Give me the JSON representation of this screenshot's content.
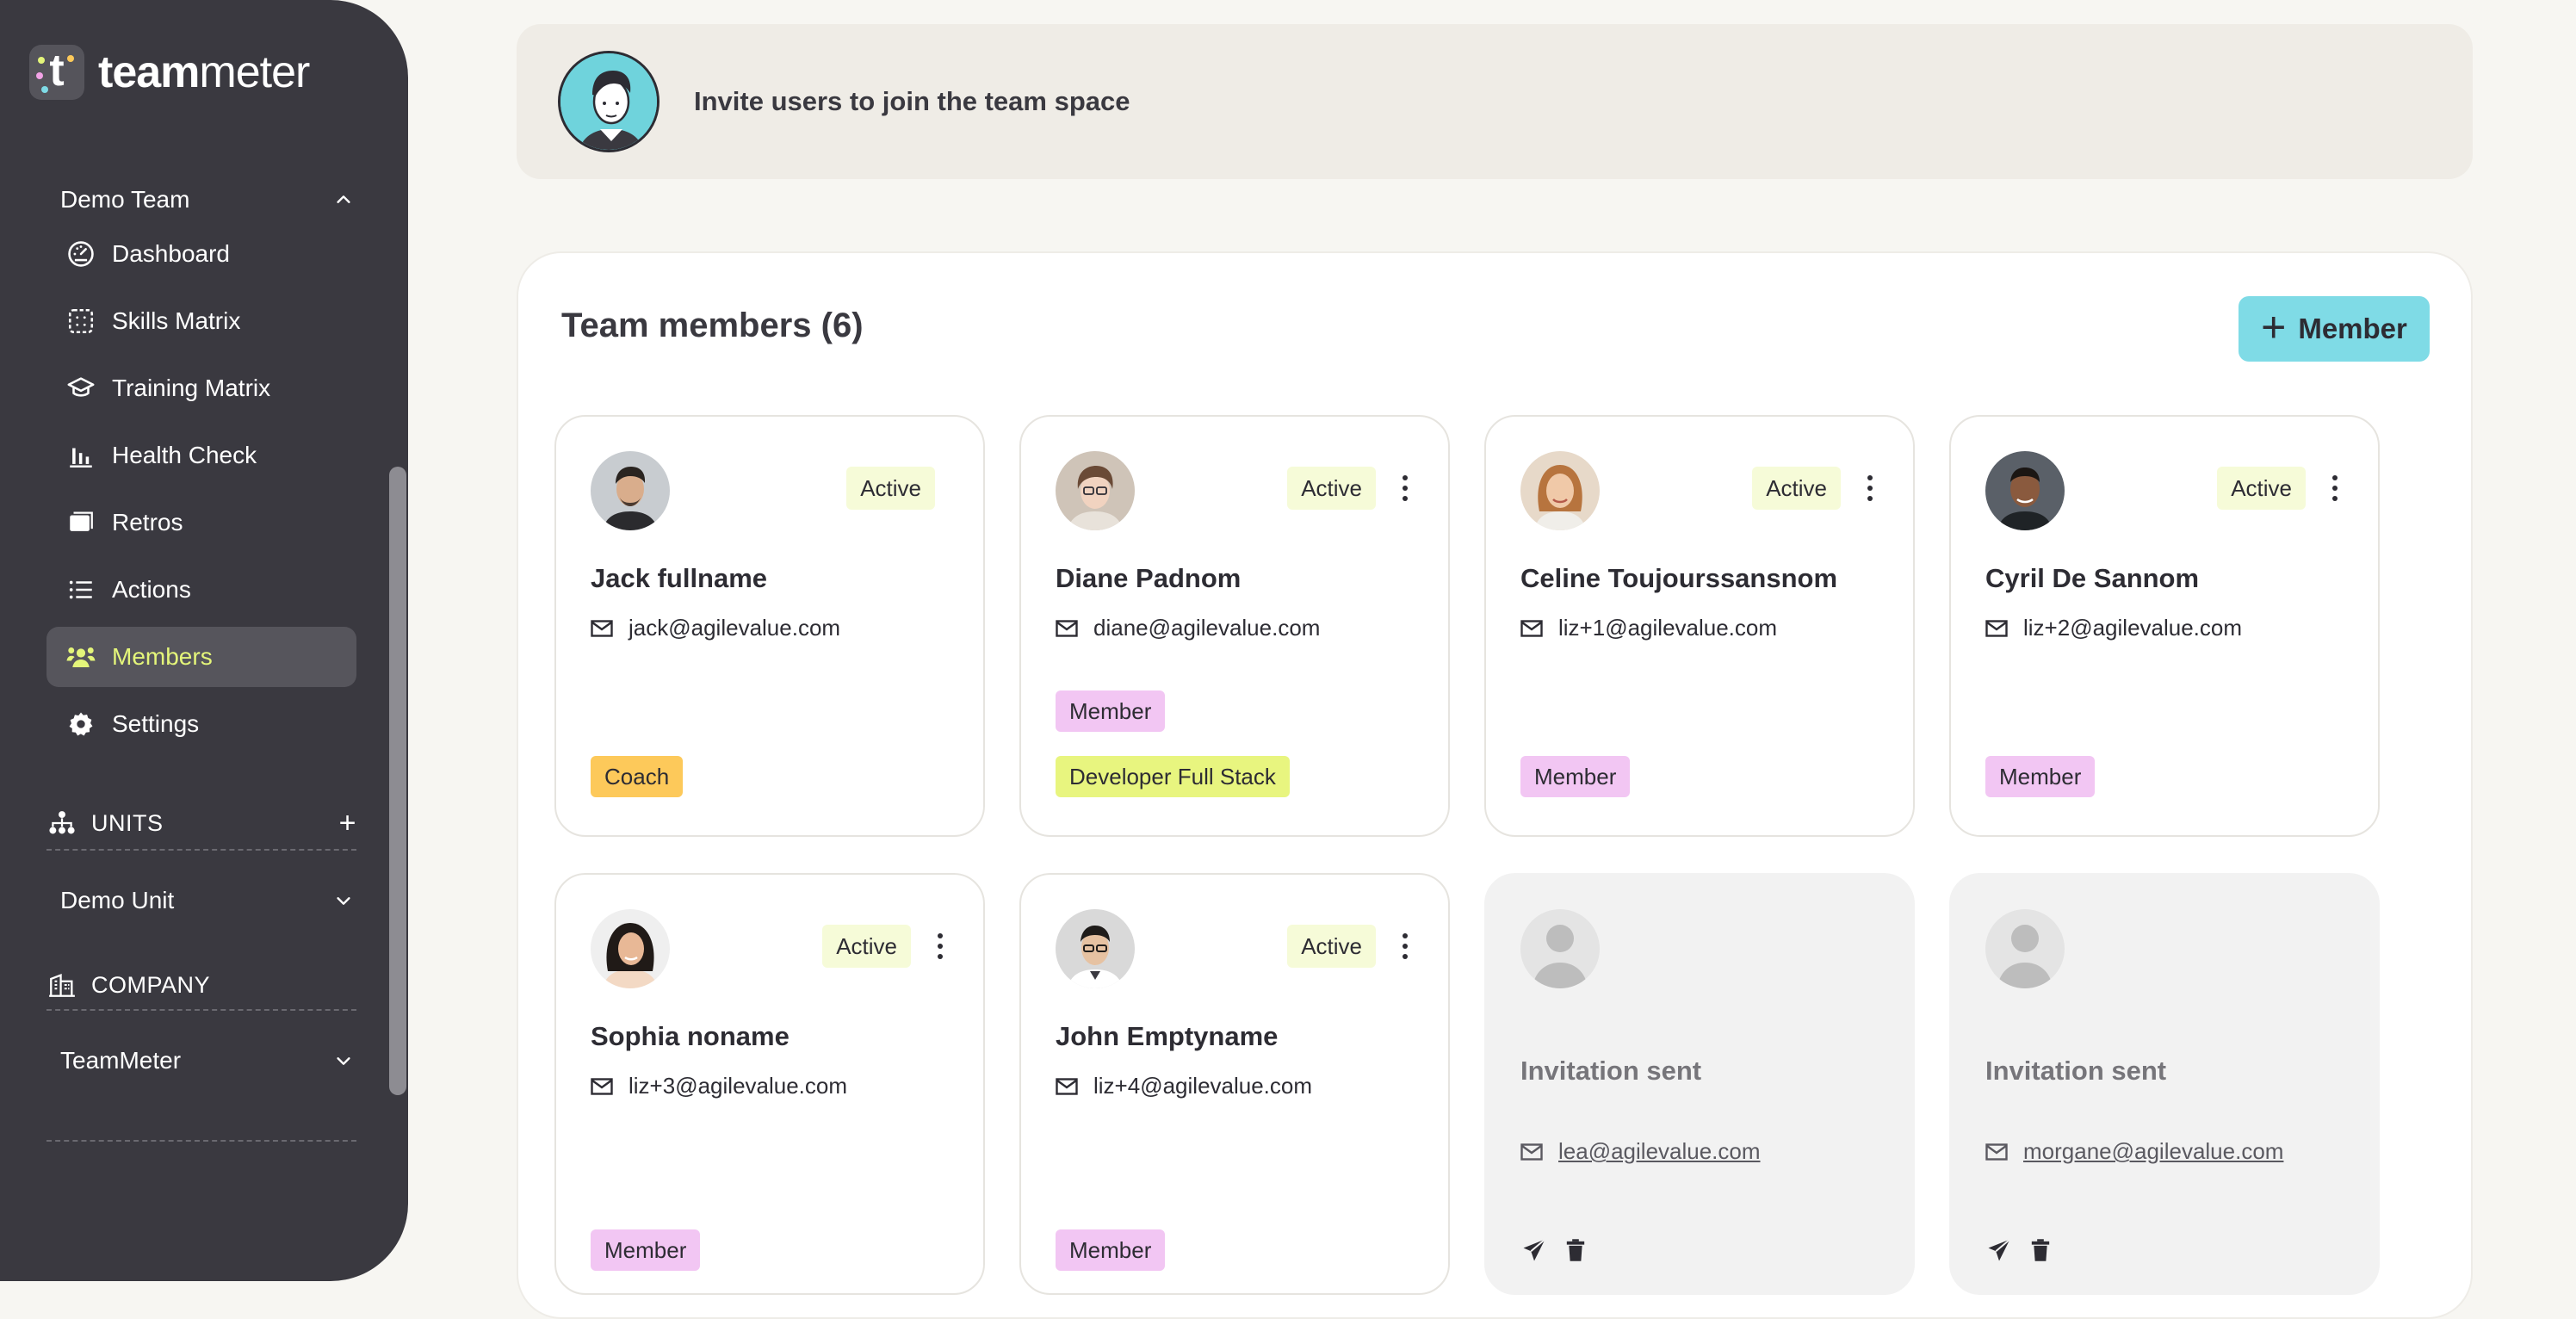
{
  "brand": {
    "name_bold": "team",
    "name_light": "meter",
    "logo_letter": "t",
    "colors": {
      "sidebar": "#3a3940",
      "active_text": "#e4f57a",
      "accent_button": "#7fdbe6",
      "status_bg": "#f6fbd8",
      "coach_tag": "#fdc95a",
      "member_tag": "#f2c6f3",
      "dev_tag": "#e8f57f"
    }
  },
  "sidebar": {
    "team": {
      "label": "Demo Team",
      "chevron": "chevron-up-icon"
    },
    "items": [
      {
        "label": "Dashboard",
        "icon": "dashboard-icon"
      },
      {
        "label": "Skills Matrix",
        "icon": "grid-icon"
      },
      {
        "label": "Training Matrix",
        "icon": "graduation-cap-icon"
      },
      {
        "label": "Health Check",
        "icon": "bar-chart-icon"
      },
      {
        "label": "Retros",
        "icon": "board-icon"
      },
      {
        "label": "Actions",
        "icon": "list-icon"
      },
      {
        "label": "Members",
        "icon": "users-icon",
        "active": true
      },
      {
        "label": "Settings",
        "icon": "gear-icon"
      }
    ],
    "units": {
      "label": "UNITS",
      "add": "+",
      "group": "Demo Unit"
    },
    "company": {
      "label": "COMPANY",
      "group": "TeamMeter"
    }
  },
  "invite": {
    "text": "Invite users to join the team space"
  },
  "members": {
    "title": "Team members (6)",
    "add_button": "Member",
    "cards": [
      {
        "name": "Jack fullname",
        "email": "jack@agilevalue.com",
        "status": "Active",
        "tags": [
          "Coach"
        ]
      },
      {
        "name": "Diane Padnom",
        "email": "diane@agilevalue.com",
        "status": "Active",
        "tags": [
          "Member",
          "Developer Full Stack"
        ]
      },
      {
        "name": "Celine Toujourssansnom",
        "email": "liz+1@agilevalue.com",
        "status": "Active",
        "tags": [
          "Member"
        ]
      },
      {
        "name": "Cyril De Sannom",
        "email": "liz+2@agilevalue.com",
        "status": "Active",
        "tags": [
          "Member"
        ]
      },
      {
        "name": "Sophia noname",
        "email": "liz+3@agilevalue.com",
        "status": "Active",
        "tags": [
          "Member"
        ]
      },
      {
        "name": "John Emptyname",
        "email": "liz+4@agilevalue.com",
        "status": "Active",
        "tags": [
          "Member"
        ]
      }
    ],
    "pending": [
      {
        "title": "Invitation sent",
        "email": "lea@agilevalue.com"
      },
      {
        "title": "Invitation sent",
        "email": "morgane@agilevalue.com"
      }
    ]
  }
}
